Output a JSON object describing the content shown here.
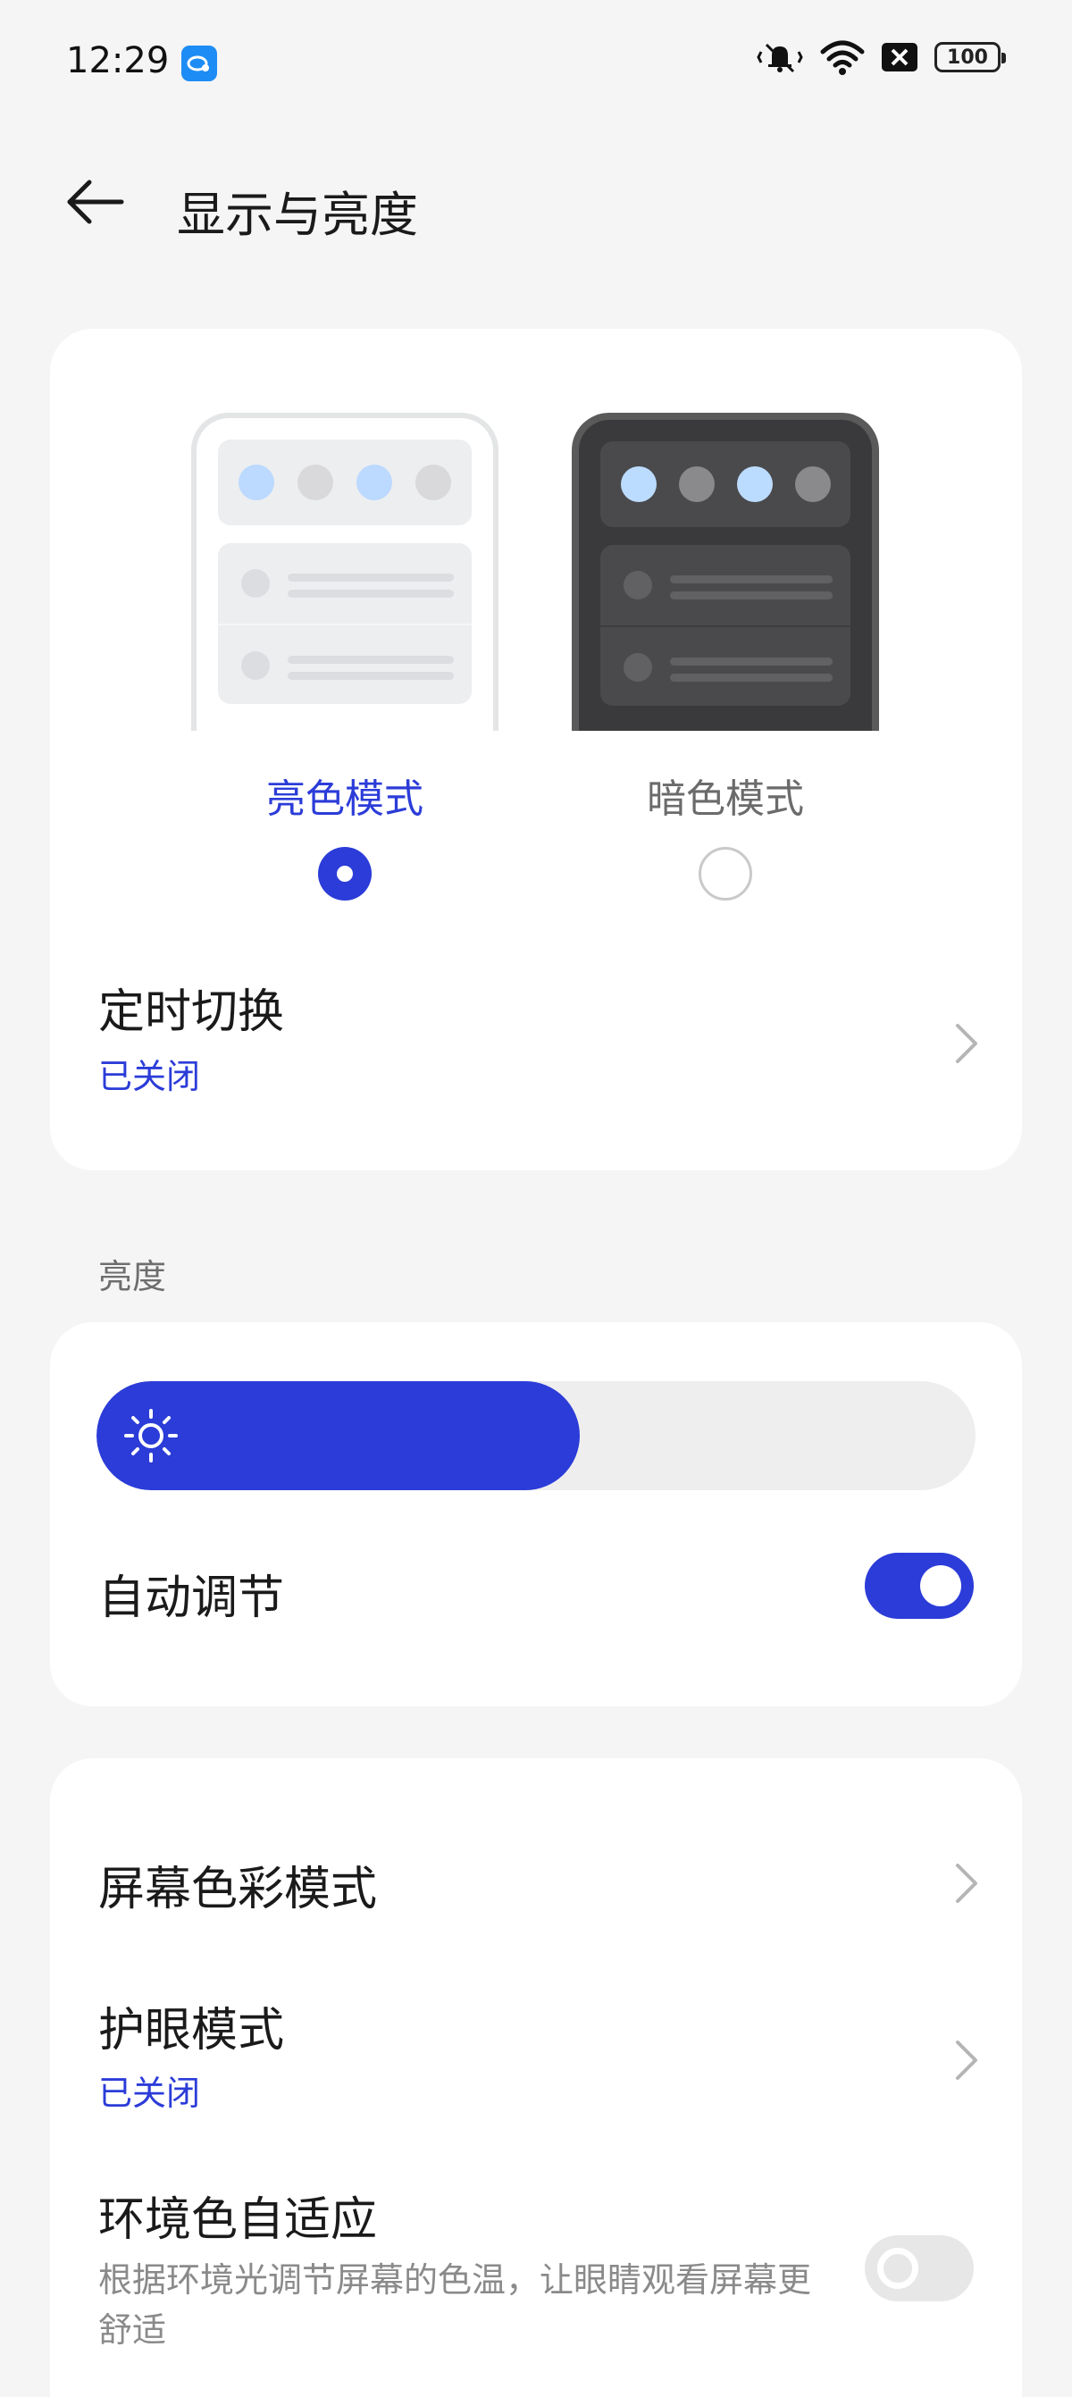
{
  "status_bar": {
    "time": "12:29",
    "battery": "100",
    "icons": [
      "app-notification-icon",
      "silent-vibrate-icon",
      "wifi-icon",
      "sim-error-icon",
      "battery-icon"
    ]
  },
  "header": {
    "title": "显示与亮度",
    "back_icon": "arrow-left-icon"
  },
  "theme": {
    "light_label": "亮色模式",
    "dark_label": "暗色模式",
    "selected": "light",
    "schedule": {
      "title": "定时切换",
      "status": "已关闭"
    }
  },
  "brightness": {
    "section_label": "亮度",
    "level_fraction": 0.55,
    "auto_adjust": {
      "title": "自动调节",
      "enabled": true
    }
  },
  "display": {
    "color_mode": {
      "title": "屏幕色彩模式"
    },
    "eye_comfort": {
      "title": "护眼模式",
      "status": "已关闭"
    },
    "ambient_adaptive": {
      "title": "环境色自适应",
      "description": "根据环境光调节屏幕的色温，让眼睛观看屏幕更舒适",
      "enabled": false
    }
  },
  "colors": {
    "accent": "#2b3cd8",
    "background": "#f5f5f5",
    "card": "#ffffff"
  }
}
